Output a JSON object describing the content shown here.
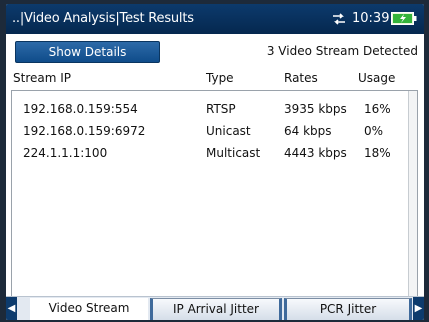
{
  "titlebar": {
    "title": "..|Video Analysis|Test Results",
    "time": "10:39",
    "network_icon": "network-activity-icon",
    "battery_icon": "battery-charging-icon"
  },
  "toolbar": {
    "show_details_label": "Show Details",
    "detected_text": "3 Video Stream Detected"
  },
  "table": {
    "columns": [
      "Stream IP",
      "Type",
      "Rates",
      "Usage"
    ],
    "rows": [
      [
        "192.168.0.159:554",
        "RTSP",
        "3935 kbps",
        "16%"
      ],
      [
        "192.168.0.159:6972",
        "Unicast",
        "64 kbps",
        "0%"
      ],
      [
        "224.1.1.1:100",
        "Multicast",
        "4443 kbps",
        "18%"
      ]
    ]
  },
  "tabs": [
    {
      "label": "Video Stream",
      "active": true
    },
    {
      "label": "IP Arrival Jitter",
      "active": false
    },
    {
      "label": "PCR Jitter",
      "active": false
    }
  ],
  "colors": {
    "titlebar": "#0c3a6c",
    "button": "#1f5c9a",
    "tab_border": "#3f6a9b"
  }
}
